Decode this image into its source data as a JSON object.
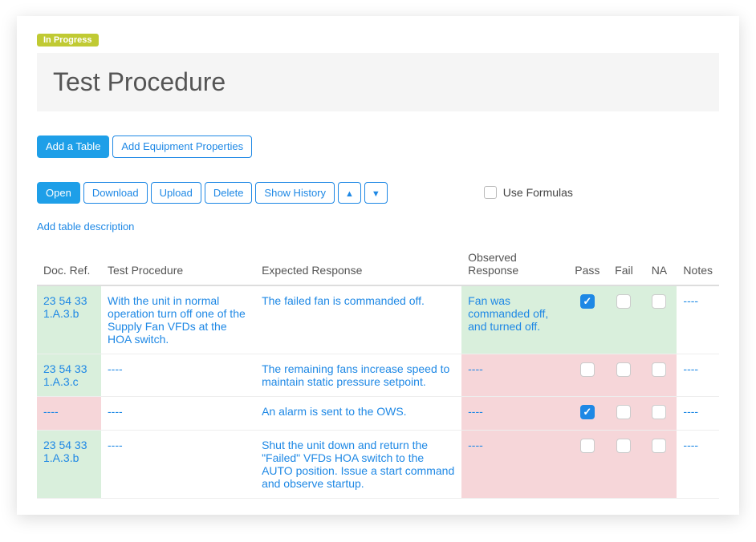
{
  "status": "In Progress",
  "page_title": "Test Procedure",
  "toolbar1": {
    "add_table": "Add a Table",
    "add_equipment": "Add Equipment Properties"
  },
  "toolbar2": {
    "open": "Open",
    "download": "Download",
    "upload": "Upload",
    "delete": "Delete",
    "show_history": "Show History",
    "use_formulas": "Use Formulas"
  },
  "table_description_link": "Add table description",
  "columns": {
    "doc_ref": "Doc. Ref.",
    "test_procedure": "Test Procedure",
    "expected": "Expected Response",
    "observed": "Observed Response",
    "pass": "Pass",
    "fail": "Fail",
    "na": "NA",
    "notes": "Notes"
  },
  "rows": [
    {
      "doc_ref": "23 54 33 1.A.3.b",
      "doc_ref_bg": "green",
      "procedure": "With the unit in normal operation turn off one of the Supply Fan VFDs at the HOA switch.",
      "expected": "The failed fan is commanded off.",
      "observed": "Fan was commanded off, and turned off.",
      "observed_bg": "green",
      "pass": true,
      "fail": false,
      "na": false,
      "pfn_bg": "green",
      "notes": "----"
    },
    {
      "doc_ref": "23 54 33 1.A.3.c",
      "doc_ref_bg": "green",
      "procedure": "----",
      "expected": "The remaining fans increase speed to maintain static pressure setpoint.",
      "observed": "----",
      "observed_bg": "pink",
      "pass": false,
      "fail": false,
      "na": false,
      "pfn_bg": "pink",
      "notes": "----"
    },
    {
      "doc_ref": "----",
      "doc_ref_bg": "pink",
      "procedure": "----",
      "expected": "An alarm is sent to the OWS.",
      "observed": "----",
      "observed_bg": "pink",
      "pass": true,
      "fail": false,
      "na": false,
      "pfn_bg": "pink",
      "notes": "----"
    },
    {
      "doc_ref": "23 54 33 1.A.3.b",
      "doc_ref_bg": "green",
      "procedure": "----",
      "expected": "Shut the unit down and return the \"Failed\" VFDs HOA switch to the AUTO position. Issue a start command and observe startup.",
      "observed": "----",
      "observed_bg": "pink",
      "pass": false,
      "fail": false,
      "na": false,
      "pfn_bg": "pink",
      "notes": "----"
    }
  ]
}
